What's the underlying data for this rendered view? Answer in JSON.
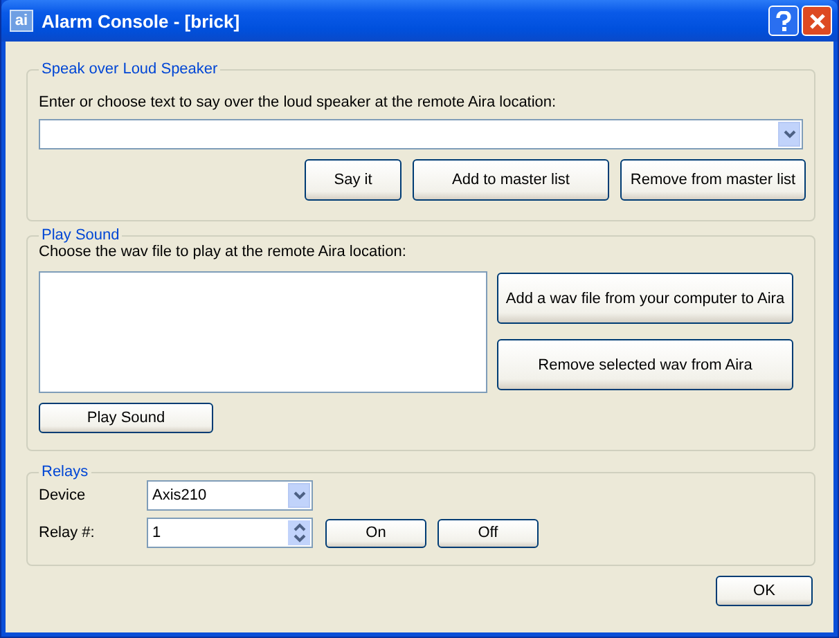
{
  "window": {
    "icon_text": "ai",
    "title": "Alarm Console - [brick]"
  },
  "speak": {
    "legend": "Speak over Loud Speaker",
    "prompt": "Enter or choose text to say over the loud speaker at the remote Aira location:",
    "buttons": [
      "Say it",
      "Add to master list",
      "Remove from master list"
    ]
  },
  "play": {
    "legend": "Play Sound",
    "prompt": "Choose the wav file to play at the remote Aira location:",
    "side_buttons": [
      "Add a wav file from your computer to Aira",
      "Remove selected wav from Aira"
    ],
    "play_button": "Play Sound"
  },
  "relays": {
    "legend": "Relays",
    "device_label": "Device",
    "device_value": "Axis210",
    "relay_label": "Relay #:",
    "relay_value": "1",
    "buttons": [
      "On",
      "Off"
    ]
  },
  "ok_button": "OK"
}
